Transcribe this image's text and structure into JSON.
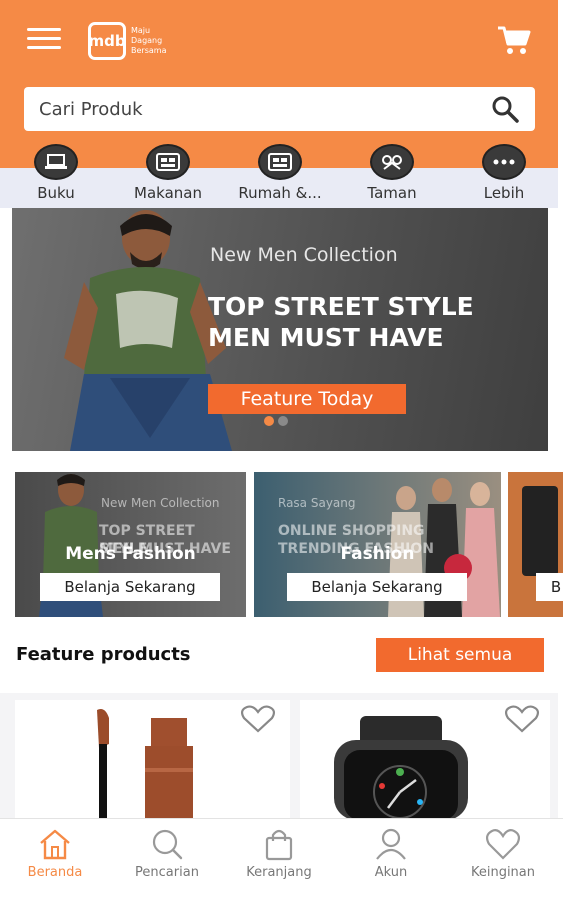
{
  "header": {
    "menu_icon": "hamburger-icon",
    "logo_mark": "mdb",
    "logo_lines": [
      "Maju",
      "Dagang",
      "Bersama"
    ],
    "cart_icon": "cart-icon",
    "accent_color": "#f58a46"
  },
  "search": {
    "placeholder": "Cari Produk",
    "icon": "search-icon"
  },
  "categories": [
    {
      "label": "Buku",
      "icon": "laptop-icon"
    },
    {
      "label": "Makanan",
      "icon": "food-icon"
    },
    {
      "label": "Rumah &...",
      "icon": "home-icon"
    },
    {
      "label": "Taman",
      "icon": "garden-icon"
    },
    {
      "label": "Lebih",
      "icon": "more-icon"
    }
  ],
  "hero": {
    "subtitle": "New Men Collection",
    "title_line1": "TOP STREET STYLE",
    "title_line2": "MEN MUST HAVE",
    "button": "Feature Today",
    "slide_index": 1,
    "slide_count": 2
  },
  "promo_cards": [
    {
      "bg_line1": "New Men Collection",
      "bg_line2": "TOP STREET STYLE",
      "bg_line3": "MEN MUST HAVE",
      "title": "Mens Fashion",
      "button": "Belanja Sekarang"
    },
    {
      "bg_line1": "Rasa Sayang",
      "bg_line2": "ONLINE SHOPPING",
      "bg_line3": "TRENDING FASHION",
      "title": "Fashion",
      "button": "Belanja Sekarang"
    },
    {
      "title": "",
      "button": "B"
    }
  ],
  "featured": {
    "title": "Feature products",
    "button": "Lihat semua"
  },
  "products": [
    {
      "image": "lipstick-image",
      "wishlist_icon": "heart-icon"
    },
    {
      "image": "smartwatch-image",
      "wishlist_icon": "heart-icon"
    }
  ],
  "bottom_nav": [
    {
      "label": "Beranda",
      "icon": "home-icon",
      "active": true
    },
    {
      "label": "Pencarian",
      "icon": "search-icon",
      "active": false
    },
    {
      "label": "Keranjang",
      "icon": "bag-icon",
      "active": false
    },
    {
      "label": "Akun",
      "icon": "user-icon",
      "active": false
    },
    {
      "label": "Keinginan",
      "icon": "heart-icon",
      "active": false
    }
  ]
}
